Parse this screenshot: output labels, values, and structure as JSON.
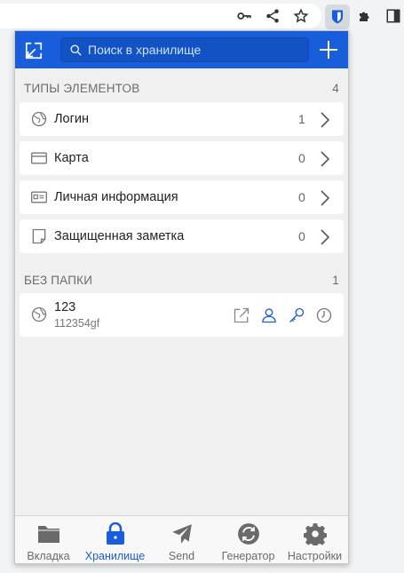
{
  "browser": {
    "icons": [
      "key-icon",
      "share-icon",
      "star-icon",
      "bitwarden-extension-icon",
      "puzzle-icon",
      "sidepanel-icon"
    ]
  },
  "header": {
    "search_placeholder": "Поиск в хранилище"
  },
  "types_section": {
    "title": "ТИПЫ ЭЛЕМЕНТОВ",
    "count": "4",
    "items": [
      {
        "label": "Логин",
        "count": "1",
        "icon": "globe-icon"
      },
      {
        "label": "Карта",
        "count": "0",
        "icon": "credit-card-icon"
      },
      {
        "label": "Личная информация",
        "count": "0",
        "icon": "id-card-icon"
      },
      {
        "label": "Защищенная заметка",
        "count": "0",
        "icon": "note-icon"
      }
    ]
  },
  "nofolder_section": {
    "title": "БЕЗ ПАПКИ",
    "count": "1",
    "items": [
      {
        "name": "123",
        "subtitle": "112354gf",
        "icon": "globe-icon"
      }
    ]
  },
  "bottom_nav": {
    "tabs": [
      {
        "label": "Вкладка",
        "icon": "folder-icon",
        "active": false
      },
      {
        "label": "Хранилище",
        "icon": "lock-icon",
        "active": true
      },
      {
        "label": "Send",
        "icon": "paper-plane-icon",
        "active": false
      },
      {
        "label": "Генератор",
        "icon": "refresh-icon",
        "active": false
      },
      {
        "label": "Настройки",
        "icon": "gear-icon",
        "active": false
      }
    ]
  },
  "colors": {
    "brand_blue": "#175ddc",
    "panel_bg": "#f0f0f0",
    "muted_icon": "#777777"
  }
}
